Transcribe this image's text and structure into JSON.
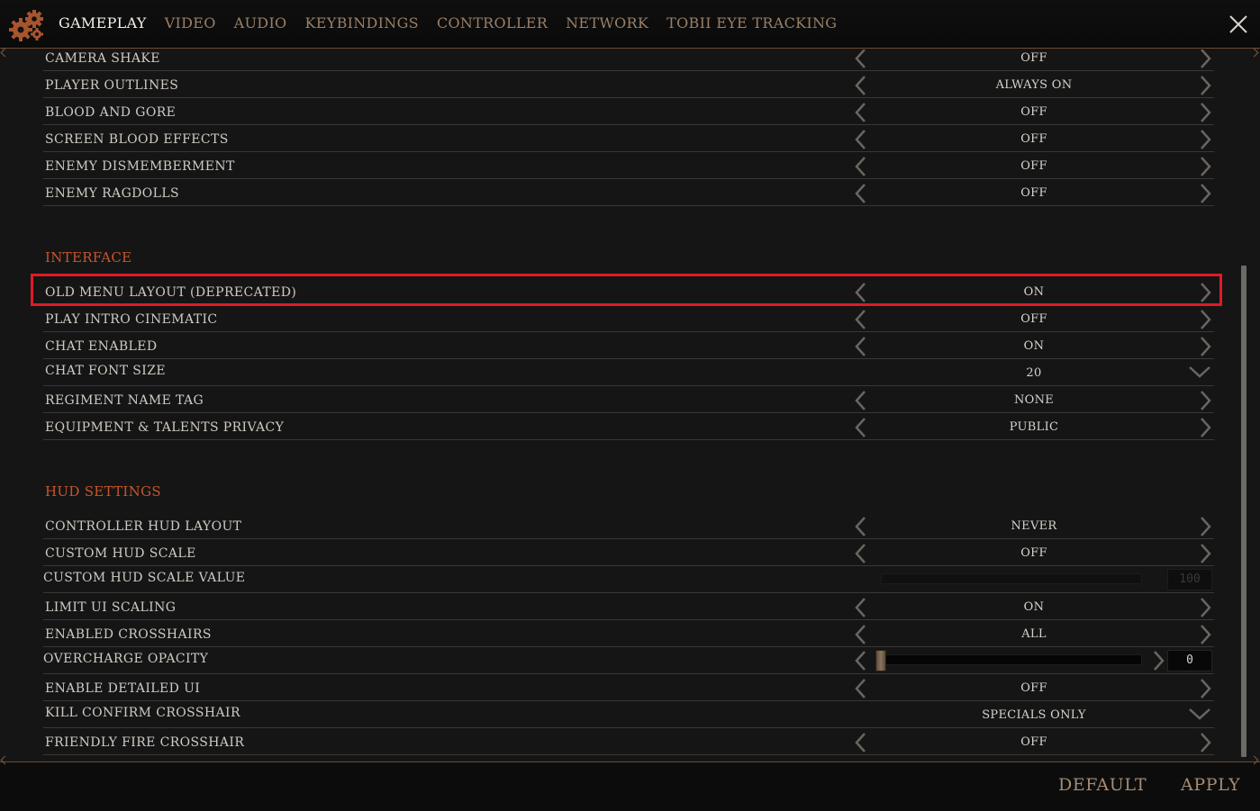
{
  "tabs": [
    {
      "label": "GAMEPLAY"
    },
    {
      "label": "VIDEO"
    },
    {
      "label": "AUDIO"
    },
    {
      "label": "KEYBINDINGS"
    },
    {
      "label": "CONTROLLER"
    },
    {
      "label": "NETWORK"
    },
    {
      "label": "TOBII EYE TRACKING"
    }
  ],
  "sections": {
    "interface": "INTERFACE",
    "hud": "HUD SETTINGS"
  },
  "rows": {
    "camera_shake": {
      "label": "CAMERA SHAKE",
      "value": "OFF"
    },
    "player_outlines": {
      "label": "PLAYER OUTLINES",
      "value": "ALWAYS ON"
    },
    "blood_gore": {
      "label": "BLOOD AND GORE",
      "value": "OFF"
    },
    "screen_blood": {
      "label": "SCREEN BLOOD EFFECTS",
      "value": "OFF"
    },
    "enemy_dismember": {
      "label": "ENEMY DISMEMBERMENT",
      "value": "OFF"
    },
    "enemy_ragdolls": {
      "label": "ENEMY RAGDOLLS",
      "value": "OFF"
    },
    "old_menu": {
      "label": "OLD MENU LAYOUT (DEPRECATED)",
      "value": "ON"
    },
    "intro_cinematic": {
      "label": "PLAY INTRO CINEMATIC",
      "value": "OFF"
    },
    "chat_enabled": {
      "label": "CHAT ENABLED",
      "value": "ON"
    },
    "chat_font": {
      "label": "CHAT FONT SIZE",
      "value": "20"
    },
    "regiment_tag": {
      "label": "REGIMENT NAME TAG",
      "value": "NONE"
    },
    "equip_privacy": {
      "label": "EQUIPMENT & TALENTS PRIVACY",
      "value": "PUBLIC"
    },
    "controller_hud": {
      "label": "CONTROLLER HUD LAYOUT",
      "value": "NEVER"
    },
    "custom_hud_scale": {
      "label": "CUSTOM HUD SCALE",
      "value": "OFF"
    },
    "custom_hud_value": {
      "label": "CUSTOM HUD SCALE VALUE",
      "value": "100"
    },
    "limit_ui": {
      "label": "LIMIT UI SCALING",
      "value": "ON"
    },
    "crosshairs": {
      "label": "ENABLED CROSSHAIRS",
      "value": "ALL"
    },
    "overcharge": {
      "label": "OVERCHARGE OPACITY",
      "value": "0"
    },
    "detailed_ui": {
      "label": "ENABLE DETAILED UI",
      "value": "OFF"
    },
    "kill_confirm": {
      "label": "KILL CONFIRM CROSSHAIR",
      "value": "SPECIALS ONLY"
    },
    "friendly_fire": {
      "label": "FRIENDLY FIRE CROSSHAIR",
      "value": "OFF"
    }
  },
  "footer": {
    "default_label": "DEFAULT",
    "apply_label": "APPLY"
  },
  "colors": {
    "accent": "#c8552c",
    "highlight": "#e01b24",
    "tab_inactive": "#9a7f66"
  },
  "icons": {
    "settings": "gear-icon",
    "close": "close-icon",
    "arrow_left": "chevron-left-icon",
    "arrow_right": "chevron-right-icon",
    "dropdown": "chevron-down-icon"
  }
}
